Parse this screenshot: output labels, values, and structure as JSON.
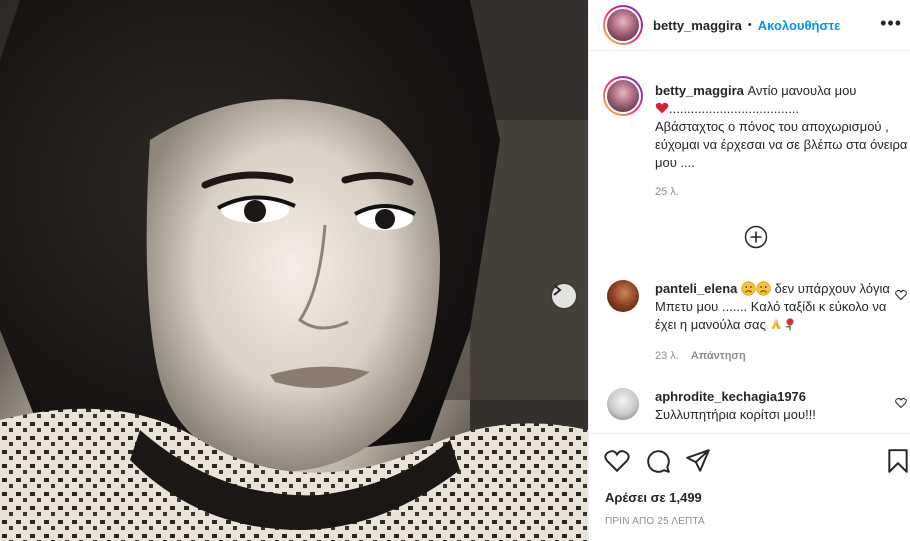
{
  "post": {
    "username": "betty_maggira",
    "follow_label": "Ακολουθήστε",
    "dot": "•",
    "more": "•••"
  },
  "caption": {
    "username": "betty_maggira",
    "line1": "Αντίο μανουλα μου",
    "dots": "....................................",
    "body": "Αβάσταχτος ο πόνος του αποχωρισμού , εύχομαι να έρχεσαι να σε βλέπω στα όνειρα μου ....",
    "time": "25 λ."
  },
  "comments": [
    {
      "username": "panteli_elena",
      "text": "δεν υπάρχουν λόγια Μπετυ μου ....... Καλό ταξίδι κ εύκολο να έχει η μανούλα σας",
      "time": "23 λ.",
      "reply_label": "Απάντηση"
    },
    {
      "username": "aphrodite_kechagia1976",
      "text": "Συλλυπητήρια κορίτσι μου!!!"
    }
  ],
  "stats": {
    "likes": "Αρέσει σε 1,499",
    "time_ago": "ΠΡΙΝ ΑΠΟ 25 ΛΕΠΤΑ"
  },
  "icons": {
    "heart": "heart-icon",
    "comment": "comment-icon",
    "share": "share-icon",
    "save": "bookmark-icon",
    "next": "chevron-right-icon",
    "load_more": "plus-circle-icon"
  },
  "colors": {
    "link": "#0095f6",
    "muted": "#8e8e8e",
    "text": "#262626"
  }
}
